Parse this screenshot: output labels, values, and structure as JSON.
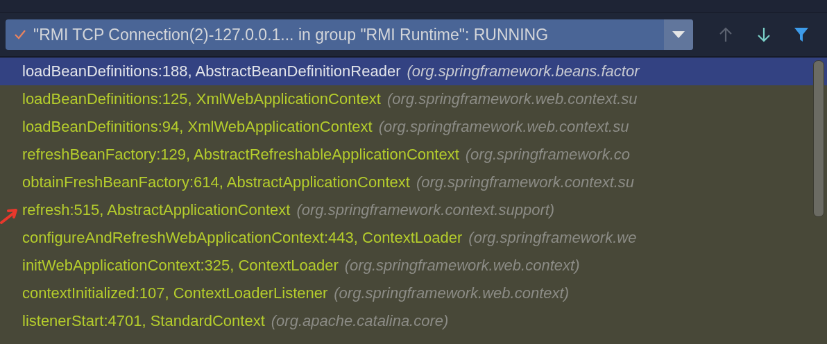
{
  "thread_selector": {
    "value": "\"RMI TCP Connection(2)-127.0.0.1... in group \"RMI Runtime\": RUNNING",
    "checked": true
  },
  "toolbar": [
    {
      "kind": "up",
      "disabled": true
    },
    {
      "kind": "down",
      "disabled": false
    },
    {
      "kind": "filter",
      "disabled": false
    }
  ],
  "frames": [
    {
      "location": "loadBeanDefinitions:188, AbstractBeanDefinitionReader",
      "package": "(org.springframework.beans.factor",
      "selected": true,
      "marked": false
    },
    {
      "location": "loadBeanDefinitions:125, XmlWebApplicationContext",
      "package": "(org.springframework.web.context.su",
      "selected": false,
      "marked": false
    },
    {
      "location": "loadBeanDefinitions:94, XmlWebApplicationContext",
      "package": "(org.springframework.web.context.su",
      "selected": false,
      "marked": false
    },
    {
      "location": "refreshBeanFactory:129, AbstractRefreshableApplicationContext",
      "package": "(org.springframework.co",
      "selected": false,
      "marked": false
    },
    {
      "location": "obtainFreshBeanFactory:614, AbstractApplicationContext",
      "package": "(org.springframework.context.su",
      "selected": false,
      "marked": false
    },
    {
      "location": "refresh:515, AbstractApplicationContext",
      "package": "(org.springframework.context.support)",
      "selected": false,
      "marked": true
    },
    {
      "location": "configureAndRefreshWebApplicationContext:443, ContextLoader",
      "package": "(org.springframework.we",
      "selected": false,
      "marked": false
    },
    {
      "location": "initWebApplicationContext:325, ContextLoader",
      "package": "(org.springframework.web.context)",
      "selected": false,
      "marked": false
    },
    {
      "location": "contextInitialized:107, ContextLoaderListener",
      "package": "(org.springframework.web.context)",
      "selected": false,
      "marked": false
    },
    {
      "location": "listenerStart:4701, StandardContext",
      "package": "(org.apache.catalina.core)",
      "selected": false,
      "marked": false
    }
  ]
}
